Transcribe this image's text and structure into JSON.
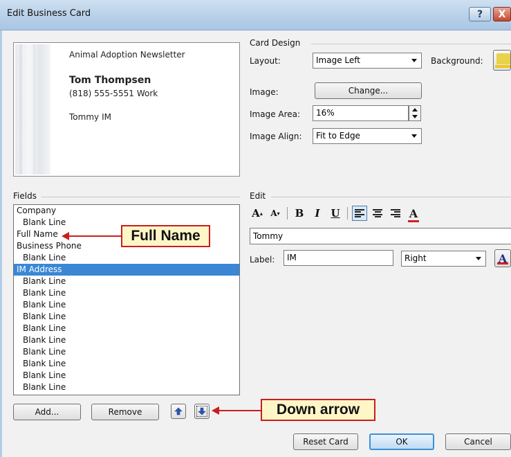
{
  "window": {
    "title": "Edit Business Card",
    "help_label": "?",
    "close_label": "X"
  },
  "preview": {
    "company": "Animal Adoption Newsletter",
    "full_name": "Tom Thompsen",
    "phone_number": "(818) 555-5551",
    "phone_label": "Work",
    "im_value": "Tommy",
    "im_label": "IM"
  },
  "card_design": {
    "heading": "Card Design",
    "layout_label": "Layout:",
    "layout_value": "Image Left",
    "background_label": "Background:",
    "image_label": "Image:",
    "change_button": "Change...",
    "image_area_label": "Image Area:",
    "image_area_value": "16%",
    "image_align_label": "Image Align:",
    "image_align_value": "Fit to Edge"
  },
  "fields": {
    "heading": "Fields",
    "items": [
      {
        "label": "Company",
        "indent": false,
        "selected": false
      },
      {
        "label": "Blank Line",
        "indent": true,
        "selected": false
      },
      {
        "label": "Full Name",
        "indent": false,
        "selected": false
      },
      {
        "label": "Business Phone",
        "indent": false,
        "selected": false
      },
      {
        "label": "Blank Line",
        "indent": true,
        "selected": false
      },
      {
        "label": "IM Address",
        "indent": false,
        "selected": true
      },
      {
        "label": "Blank Line",
        "indent": true,
        "selected": false
      },
      {
        "label": "Blank Line",
        "indent": true,
        "selected": false
      },
      {
        "label": "Blank Line",
        "indent": true,
        "selected": false
      },
      {
        "label": "Blank Line",
        "indent": true,
        "selected": false
      },
      {
        "label": "Blank Line",
        "indent": true,
        "selected": false
      },
      {
        "label": "Blank Line",
        "indent": true,
        "selected": false
      },
      {
        "label": "Blank Line",
        "indent": true,
        "selected": false
      },
      {
        "label": "Blank Line",
        "indent": true,
        "selected": false
      },
      {
        "label": "Blank Line",
        "indent": true,
        "selected": false
      },
      {
        "label": "Blank Line",
        "indent": true,
        "selected": false
      },
      {
        "label": "Blank Line",
        "indent": true,
        "selected": false
      }
    ],
    "add_button": "Add...",
    "remove_button": "Remove"
  },
  "edit": {
    "heading": "Edit",
    "grow_font": "A",
    "shrink_font": "A",
    "bold": "B",
    "italic": "I",
    "underline": "U",
    "font_color": "A",
    "text_value": "Tommy",
    "label_label": "Label:",
    "label_value": "IM",
    "label_position": "Right",
    "label_color": "A"
  },
  "buttons": {
    "reset": "Reset Card",
    "ok": "OK",
    "cancel": "Cancel"
  },
  "callouts": {
    "full_name": "Full Name",
    "down_arrow": "Down arrow"
  },
  "colors": {
    "selection": "#3a87d5",
    "callout_border": "#c81e1e",
    "callout_fill": "#fff6c8",
    "titlebar": "#bcd3ea"
  }
}
